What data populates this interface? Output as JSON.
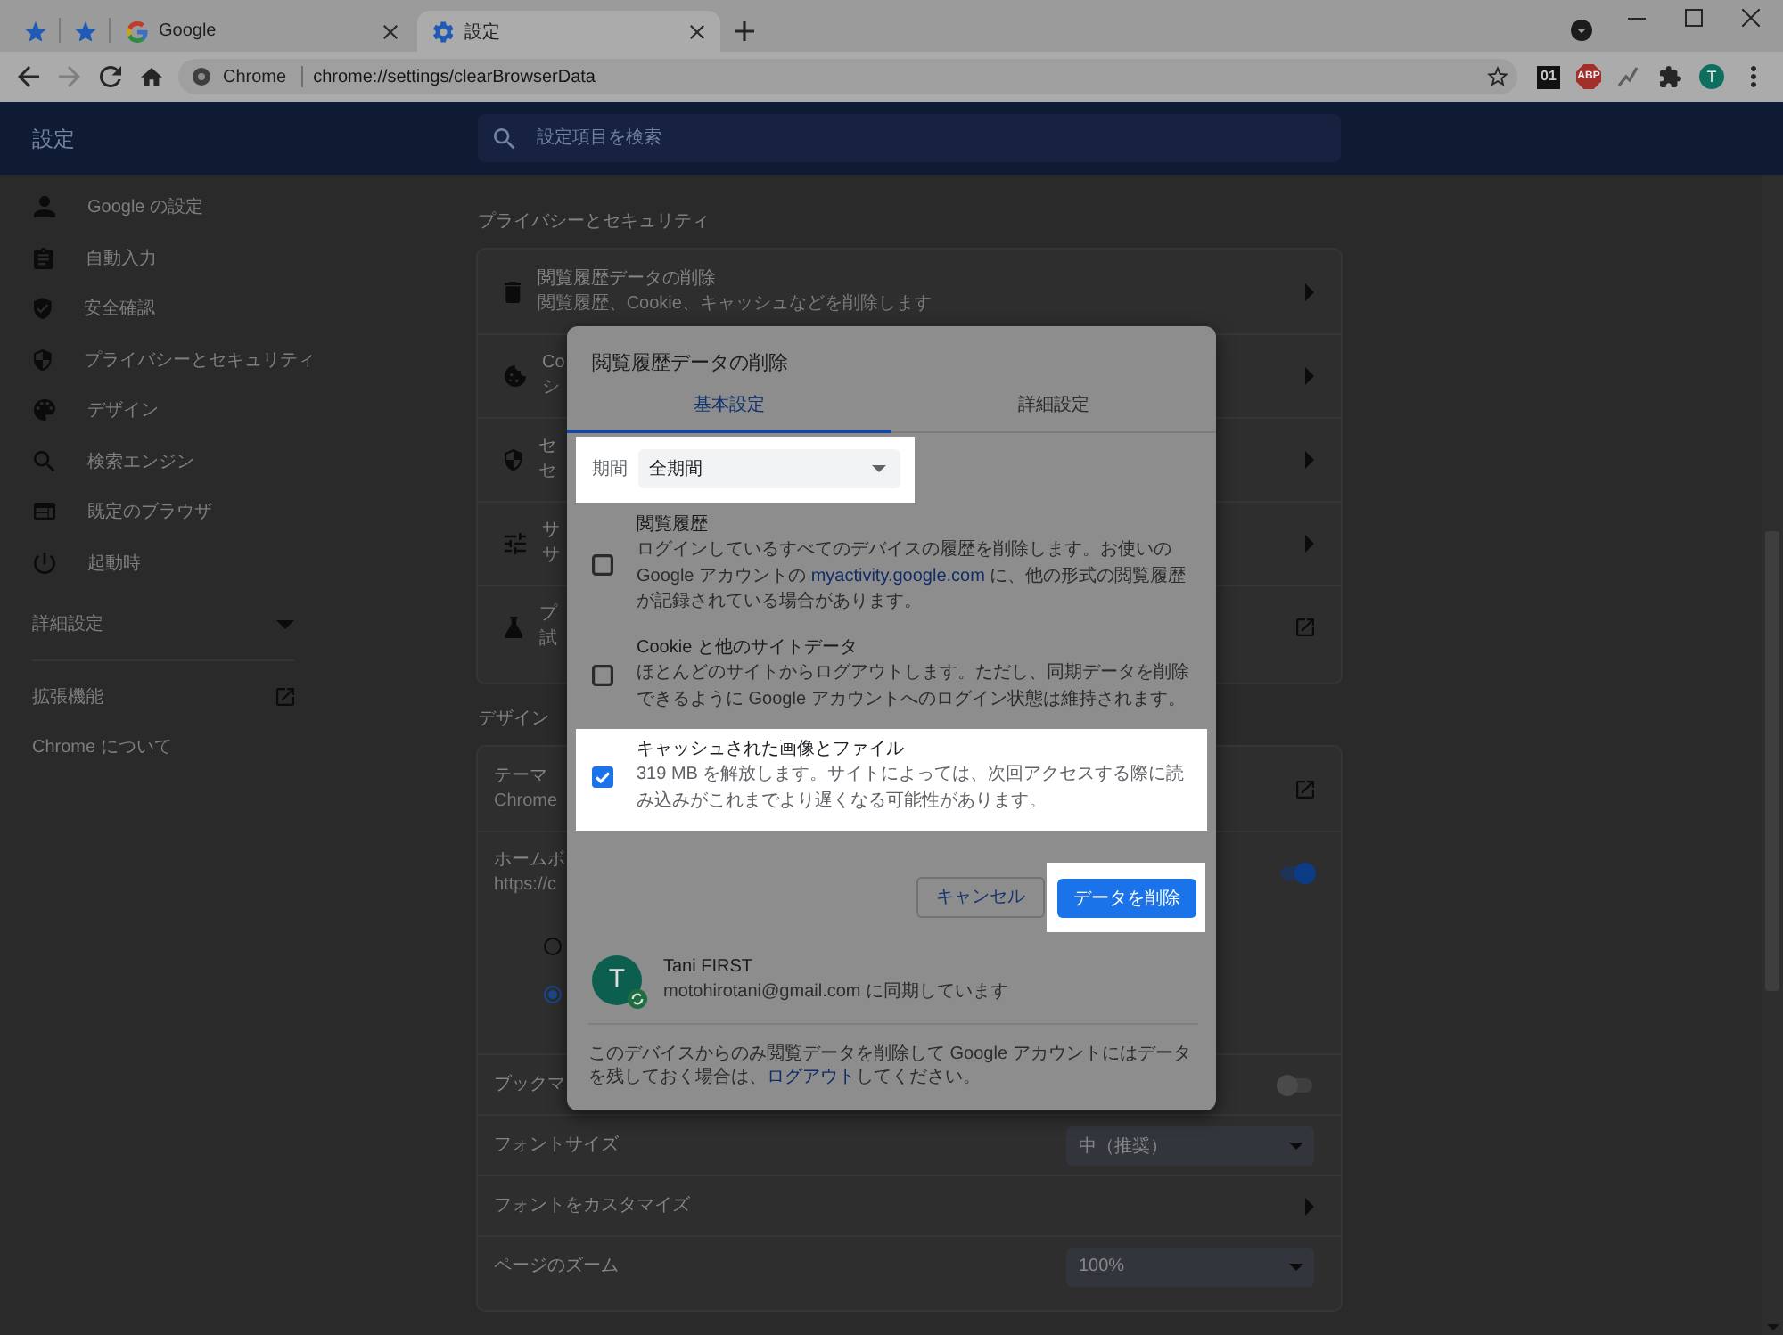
{
  "browser": {
    "tabs": [
      {
        "kind": "pinned",
        "selected": false
      },
      {
        "kind": "pinned",
        "selected": false
      },
      {
        "kind": "page",
        "title": "Google",
        "selected": false
      },
      {
        "kind": "page",
        "title": "設定",
        "selected": true
      }
    ],
    "toolbar": {
      "forward_disabled": true,
      "site_chip": "Chrome",
      "url": "chrome://settings/clearBrowserData",
      "extensions": [
        {
          "kind": "tile",
          "label": "01"
        },
        {
          "kind": "octagon",
          "label": "ABP"
        }
      ],
      "profile_initial": "T"
    }
  },
  "settings": {
    "header": {
      "title": "設定",
      "search_placeholder": "設定項目を検索"
    },
    "sidebar": {
      "items": [
        {
          "label": "Google の設定"
        },
        {
          "label": "自動入力"
        },
        {
          "label": "安全確認"
        },
        {
          "label": "プライバシーとセキュリティ"
        },
        {
          "label": "デザイン"
        },
        {
          "label": "検索エンジン"
        },
        {
          "label": "既定のブラウザ"
        },
        {
          "label": "起動時"
        }
      ],
      "advanced": {
        "label": "詳細設定",
        "expanded": false
      },
      "links": [
        {
          "kind": "external",
          "label": "拡張機能"
        },
        {
          "kind": "plain",
          "label": "Chrome について"
        }
      ]
    },
    "sections": [
      {
        "title": "プライバシーとセキュリティ",
        "rows": [
          {
            "kind": "link",
            "title": "閲覧履歴データの削除",
            "subtitle": "閲覧履歴、Cookie、キャッシュなどを削除します"
          },
          {
            "kind": "link",
            "title": "Co",
            "subtitle": "シ"
          },
          {
            "kind": "link",
            "title": "セ",
            "subtitle": "セ"
          },
          {
            "kind": "link",
            "title": "サ",
            "subtitle": "サ"
          },
          {
            "kind": "external",
            "title": "プ",
            "subtitle": "試"
          }
        ]
      },
      {
        "title": "デザイン",
        "rows": [
          {
            "kind": "external",
            "title": "テーマ",
            "subtitle": "Chrome"
          },
          {
            "kind": "toggle",
            "title": "ホームボ",
            "subtitle": "https://c",
            "on": true
          },
          {
            "kind": "radio",
            "selected": false
          },
          {
            "kind": "radio",
            "selected": true
          },
          {
            "kind": "toggle",
            "title": "ブックマ",
            "on": false
          },
          {
            "kind": "select",
            "title": "フォントサイズ",
            "value": "中（推奨）"
          },
          {
            "kind": "link",
            "title": "フォントをカスタマイズ"
          },
          {
            "kind": "select",
            "title": "ページのズーム",
            "value": "100%"
          }
        ]
      }
    ]
  },
  "dialog": {
    "title": "閲覧履歴データの削除",
    "tabs": [
      {
        "label": "基本設定",
        "selected": true
      },
      {
        "label": "詳細設定",
        "selected": false
      }
    ],
    "time_range": {
      "label": "期間",
      "value": "全期間",
      "highlighted": true
    },
    "items": [
      {
        "title": "閲覧履歴",
        "description": "ログインしているすべてのデバイスの履歴を削除します。お使いの Google アカウントの ",
        "link": "myactivity.google.com",
        "description_after": " に、他の形式の閲覧履歴が記録されている場合があります。",
        "checked": false,
        "highlighted": false
      },
      {
        "title": "Cookie と他のサイトデータ",
        "description": "ほとんどのサイトからログアウトします。ただし、同期データを削除できるように Google アカウントへのログイン状態は維持されます。",
        "checked": false,
        "highlighted": false
      },
      {
        "title": "キャッシュされた画像とファイル",
        "description": "319 MB を解放します。サイトによっては、次回アクセスする際に読み込みがこれまでより遅くなる可能性があります。",
        "checked": true,
        "highlighted": true
      }
    ],
    "buttons": [
      {
        "kind": "outline",
        "label": "キャンセル",
        "highlighted": false
      },
      {
        "kind": "primary",
        "label": "データを削除",
        "highlighted": true
      }
    ],
    "account": {
      "initial": "T",
      "name": "Tani FIRST",
      "status": "motohirotani@gmail.com に同期しています"
    },
    "footer": {
      "text": "このデバイスからのみ閲覧データを削除して Google アカウントにはデータを残しておく場合は、",
      "link": "ログアウト",
      "text_after": "してください。"
    }
  }
}
